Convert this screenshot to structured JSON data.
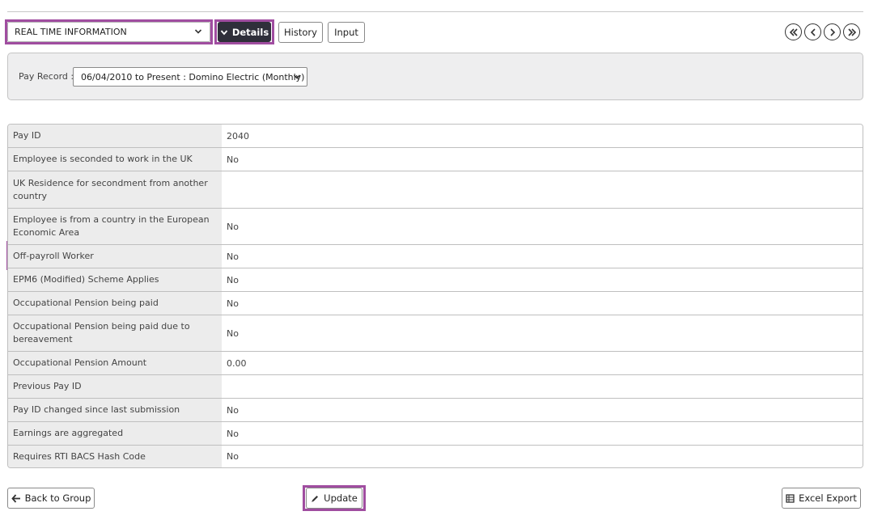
{
  "toolbar": {
    "section_select_value": "REAL TIME INFORMATION",
    "details_label": "Details",
    "history_label": "History",
    "input_label": "Input"
  },
  "navigation": {
    "first_icon": "double-chevron-left-icon",
    "prev_icon": "chevron-left-icon",
    "next_icon": "chevron-right-icon",
    "last_icon": "double-chevron-right-icon"
  },
  "pay_record": {
    "label": "Pay Record :",
    "value": "06/04/2010 to Present : Domino Electric (Monthly)"
  },
  "rows": [
    {
      "label": "Pay ID",
      "value": "2040"
    },
    {
      "label": "Employee is seconded to work in the UK",
      "value": "No"
    },
    {
      "label": "UK Residence for secondment from another country",
      "value": ""
    },
    {
      "label": "Employee is from a country in the European Economic Area",
      "value": "No"
    },
    {
      "label": "Off-payroll Worker",
      "value": "No"
    },
    {
      "label": "EPM6 (Modified) Scheme Applies",
      "value": "No"
    },
    {
      "label": "Occupational Pension being paid",
      "value": "No"
    },
    {
      "label": "Occupational Pension being paid due to bereavement",
      "value": "No"
    },
    {
      "label": "Occupational Pension Amount",
      "value": "0.00"
    },
    {
      "label": "Previous Pay ID",
      "value": ""
    },
    {
      "label": "Pay ID changed since last submission",
      "value": "No"
    },
    {
      "label": "Earnings are aggregated",
      "value": "No"
    },
    {
      "label": "Requires RTI BACS Hash Code",
      "value": "No"
    }
  ],
  "footer": {
    "back_label": "Back to Group",
    "update_label": "Update",
    "excel_label": "Excel Export"
  },
  "colors": {
    "highlight": "#a04da0",
    "details_button_bg": "#2f2f3a",
    "label_cell_bg": "#ececec",
    "panel_bg": "#eeeeef"
  }
}
